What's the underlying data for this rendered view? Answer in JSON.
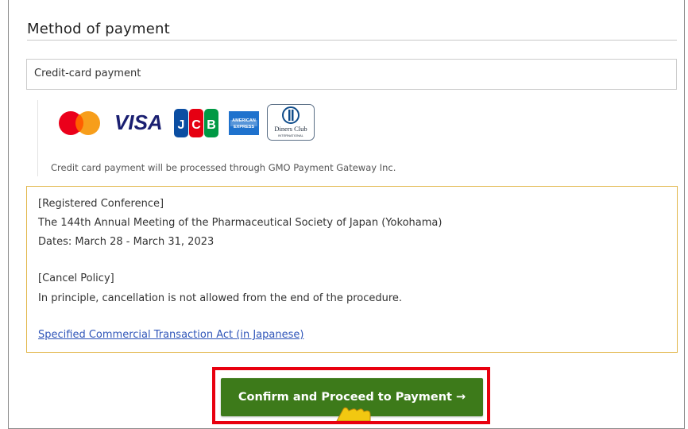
{
  "section": {
    "title": "Method of payment"
  },
  "payment_method": {
    "selected_label": "Credit-card payment"
  },
  "card_brands": [
    {
      "name": "mastercard-logo"
    },
    {
      "name": "visa-logo",
      "text": "VISA"
    },
    {
      "name": "jcb-logo",
      "text": "JCB"
    },
    {
      "name": "amex-logo",
      "text": "AMERICAN EXPRESS"
    },
    {
      "name": "diners-club-logo",
      "text": "Diners Club INTERNATIONAL"
    }
  ],
  "gateway_note": "Credit card payment will be processed through GMO Payment Gateway Inc.",
  "conference": {
    "registered_heading": "[Registered Conference]",
    "name": "The 144th Annual Meeting of the Pharmaceutical Society of Japan (Yokohama)",
    "dates": "Dates: March 28 - March 31, 2023",
    "cancel_heading": "[Cancel Policy]",
    "cancel_text": "In principle, cancellation is not allowed from the end of the procedure.",
    "act_link": "Specified Commercial Transaction Act (in Japanese)"
  },
  "confirm_button": {
    "label": "Confirm and Proceed to Payment →"
  },
  "colors": {
    "button_green": "#3d7a1a",
    "highlight_red": "#e8000f",
    "box_border_gold": "#e2b64a",
    "link_blue": "#3056b9",
    "cursor_yellow": "#f2c811"
  }
}
